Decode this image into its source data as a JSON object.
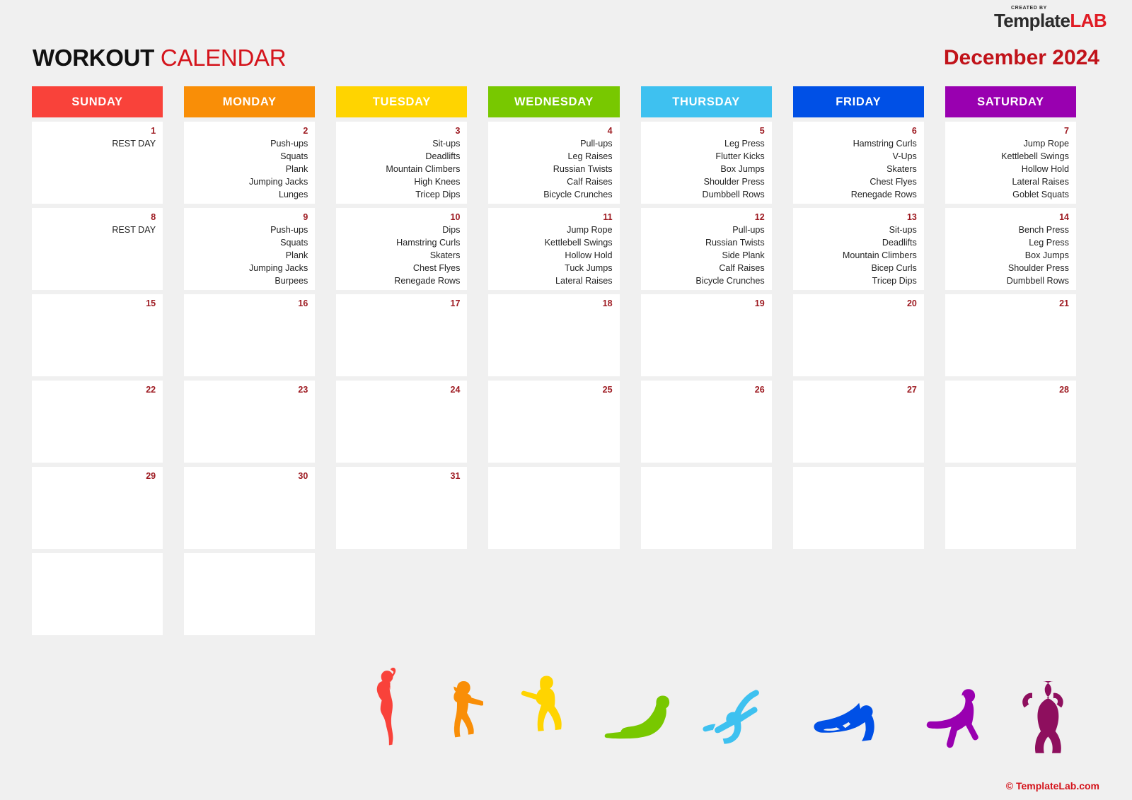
{
  "brand": {
    "created_by": "CREATED BY",
    "name_dark": "Template",
    "name_accent": "LAB"
  },
  "header": {
    "title_bold": "WORKOUT",
    "title_accent": "CALENDAR",
    "month": "December 2024"
  },
  "colors": {
    "background": "#f0f0f0",
    "title_dark": "#111111",
    "title_accent": "#d4141c",
    "month": "#c1131a",
    "daynum": "#9e1b22",
    "cell": "#ffffff",
    "sunday": "#f9423a",
    "monday": "#f98e07",
    "tuesday": "#ffd400",
    "wednesday": "#78c800",
    "thursday": "#3ec1f0",
    "friday": "#0050e6",
    "saturday": "#9900b0"
  },
  "day_headers": [
    {
      "label": "SUNDAY",
      "color": "#f9423a"
    },
    {
      "label": "MONDAY",
      "color": "#f98e07"
    },
    {
      "label": "TUESDAY",
      "color": "#ffd400"
    },
    {
      "label": "WEDNESDAY",
      "color": "#78c800"
    },
    {
      "label": "THURSDAY",
      "color": "#3ec1f0"
    },
    {
      "label": "FRIDAY",
      "color": "#0050e6"
    },
    {
      "label": "SATURDAY",
      "color": "#9900b0"
    }
  ],
  "weeks": [
    [
      {
        "day": "1",
        "exercises": [
          "REST DAY"
        ]
      },
      {
        "day": "2",
        "exercises": [
          "Push-ups",
          "Squats",
          "Plank",
          "Jumping Jacks",
          "Lunges"
        ]
      },
      {
        "day": "3",
        "exercises": [
          "Sit-ups",
          "Deadlifts",
          "Mountain Climbers",
          "High Knees",
          "Tricep Dips"
        ]
      },
      {
        "day": "4",
        "exercises": [
          "Pull-ups",
          "Leg Raises",
          "Russian Twists",
          "Calf Raises",
          "Bicycle Crunches"
        ]
      },
      {
        "day": "5",
        "exercises": [
          "Leg Press",
          "Flutter Kicks",
          "Box Jumps",
          "Shoulder Press",
          "Dumbbell Rows"
        ]
      },
      {
        "day": "6",
        "exercises": [
          "Hamstring Curls",
          "V-Ups",
          "Skaters",
          "Chest Flyes",
          "Renegade Rows"
        ]
      },
      {
        "day": "7",
        "exercises": [
          "Jump Rope",
          "Kettlebell Swings",
          "Hollow Hold",
          "Lateral Raises",
          "Goblet Squats"
        ]
      }
    ],
    [
      {
        "day": "8",
        "exercises": [
          "REST DAY"
        ]
      },
      {
        "day": "9",
        "exercises": [
          "Push-ups",
          "Squats",
          "Plank",
          "Jumping Jacks",
          "Burpees"
        ]
      },
      {
        "day": "10",
        "exercises": [
          "Dips",
          "Hamstring Curls",
          "Skaters",
          "Chest Flyes",
          "Renegade Rows"
        ]
      },
      {
        "day": "11",
        "exercises": [
          "Jump Rope",
          "Kettlebell Swings",
          "Hollow Hold",
          "Tuck Jumps",
          "Lateral Raises"
        ]
      },
      {
        "day": "12",
        "exercises": [
          "Pull-ups",
          "Russian Twists",
          "Side Plank",
          "Calf Raises",
          "Bicycle Crunches"
        ]
      },
      {
        "day": "13",
        "exercises": [
          "Sit-ups",
          "Deadlifts",
          "Mountain Climbers",
          "Bicep Curls",
          "Tricep Dips"
        ]
      },
      {
        "day": "14",
        "exercises": [
          "Bench Press",
          "Leg Press",
          "Box Jumps",
          "Shoulder Press",
          "Dumbbell Rows"
        ]
      }
    ],
    [
      {
        "day": "15",
        "exercises": []
      },
      {
        "day": "16",
        "exercises": []
      },
      {
        "day": "17",
        "exercises": []
      },
      {
        "day": "18",
        "exercises": []
      },
      {
        "day": "19",
        "exercises": []
      },
      {
        "day": "20",
        "exercises": []
      },
      {
        "day": "21",
        "exercises": []
      }
    ],
    [
      {
        "day": "22",
        "exercises": []
      },
      {
        "day": "23",
        "exercises": []
      },
      {
        "day": "24",
        "exercises": []
      },
      {
        "day": "25",
        "exercises": []
      },
      {
        "day": "26",
        "exercises": []
      },
      {
        "day": "27",
        "exercises": []
      },
      {
        "day": "28",
        "exercises": []
      }
    ],
    [
      {
        "day": "29",
        "exercises": []
      },
      {
        "day": "30",
        "exercises": []
      },
      {
        "day": "31",
        "exercises": []
      },
      {
        "day": "",
        "exercises": []
      },
      {
        "day": "",
        "exercises": []
      },
      {
        "day": "",
        "exercises": []
      },
      {
        "day": "",
        "exercises": []
      }
    ],
    [
      {
        "day": "",
        "exercises": []
      },
      {
        "day": "",
        "exercises": []
      },
      {
        "day": "",
        "exercises": [],
        "empty": true
      },
      {
        "day": "",
        "exercises": [],
        "empty": true
      },
      {
        "day": "",
        "exercises": [],
        "empty": true
      },
      {
        "day": "",
        "exercises": [],
        "empty": true
      },
      {
        "day": "",
        "exercises": [],
        "empty": true
      }
    ]
  ],
  "figures": [
    {
      "name": "stretch-reach-figure",
      "color": "#f9423a"
    },
    {
      "name": "squat-punch-figure",
      "color": "#f98e07"
    },
    {
      "name": "squat-figure",
      "color": "#ffd400"
    },
    {
      "name": "cobra-stretch-figure",
      "color": "#78c800"
    },
    {
      "name": "bicycle-crunch-figure",
      "color": "#3ec1f0"
    },
    {
      "name": "plank-figure",
      "color": "#0050e6"
    },
    {
      "name": "lunge-stretch-figure",
      "color": "#9900b0"
    },
    {
      "name": "sit-up-figure",
      "color": "#8e0f5e"
    }
  ],
  "footer": {
    "copyright": "© TemplateLab.com"
  }
}
